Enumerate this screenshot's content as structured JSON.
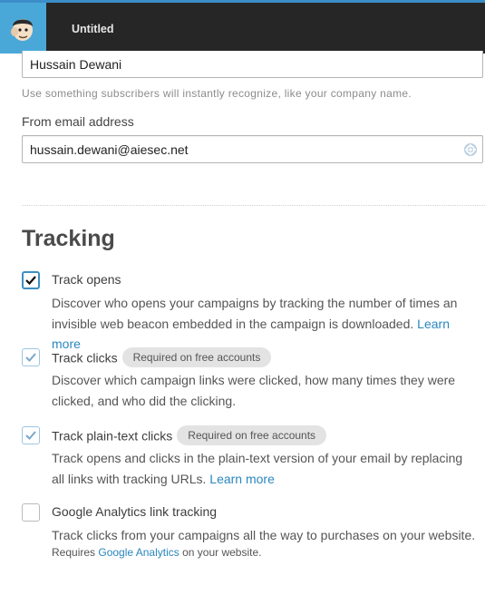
{
  "header": {
    "title": "Untitled",
    "logo": "mailchimp-monkey-logo",
    "accent_color": "#4aa8d8",
    "bar_color": "#262626"
  },
  "from_name": {
    "value": "Hussain Dewani",
    "helper": "Use something subscribers will instantly recognize, like your company name."
  },
  "from_email": {
    "label": "From email address",
    "value": "hussain.dewani@aiesec.net",
    "icon": "lifebuoy-icon"
  },
  "tracking": {
    "title": "Tracking",
    "options": [
      {
        "title": "Track opens",
        "checked": true,
        "badge": "",
        "desc": "Discover who opens your campaigns by tracking the number of times an invisible web beacon embedded in the campaign is downloaded.",
        "link": "Learn more"
      },
      {
        "title": "Track clicks",
        "checked": true,
        "badge": "Required on free accounts",
        "desc": "Discover which campaign links were clicked, how many times they were clicked, and who did the clicking.",
        "link": ""
      },
      {
        "title": "Track plain-text clicks",
        "checked": true,
        "badge": "Required on free accounts",
        "desc": "Track opens and clicks in the plain-text version of your email by replacing all links with tracking URLs.",
        "link": "Learn more"
      },
      {
        "title": "Google Analytics link tracking",
        "checked": false,
        "badge": "",
        "desc": "Track clicks from your campaigns all the way to purchases on your website.",
        "note_prefix": "Requires",
        "note_link": "Google Analytics",
        "note_suffix": "on your website."
      }
    ]
  }
}
